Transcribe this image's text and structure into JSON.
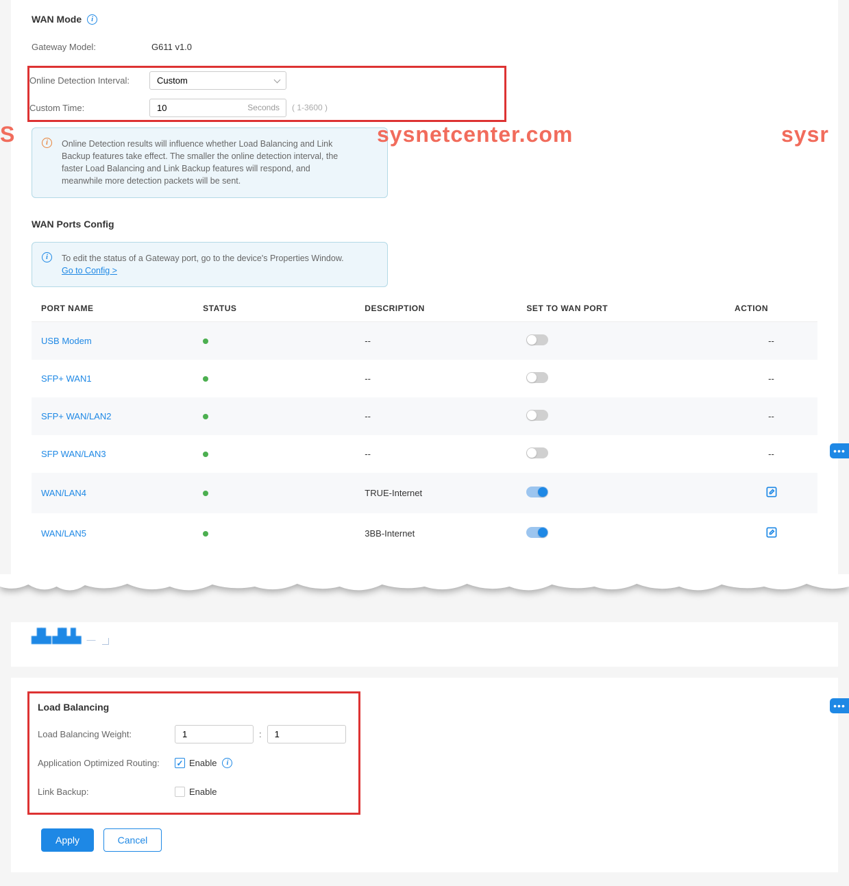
{
  "watermarks": {
    "w1": "S",
    "w2": "sysnetcenter.com",
    "w3": "sysr"
  },
  "wan_mode": {
    "title": "WAN Mode",
    "gateway_model_label": "Gateway Model:",
    "gateway_model_value": "G611 v1.0",
    "detection_label": "Online Detection Interval:",
    "detection_value": "Custom",
    "custom_time_label": "Custom Time:",
    "custom_time_value": "10",
    "custom_time_unit": "Seconds",
    "custom_time_range": "( 1-3600 )",
    "info_text": "Online Detection results will influence whether Load Balancing and Link Backup features take effect. The smaller the online detection interval, the faster Load Balancing and Link Backup features will respond, and meanwhile more detection packets will be sent."
  },
  "wan_ports": {
    "title": "WAN Ports Config",
    "info_text": "To edit the status of a Gateway port, go to the device's Properties Window.",
    "info_link": "Go to Config >",
    "headers": {
      "port": "PORT NAME",
      "status": "STATUS",
      "desc": "DESCRIPTION",
      "wan": "SET TO WAN PORT",
      "action": "ACTION"
    },
    "rows": [
      {
        "name": "USB Modem",
        "desc": "--",
        "wan": false,
        "action": "--"
      },
      {
        "name": "SFP+ WAN1",
        "desc": "--",
        "wan": false,
        "action": "--"
      },
      {
        "name": "SFP+ WAN/LAN2",
        "desc": "--",
        "wan": false,
        "action": "--"
      },
      {
        "name": "SFP WAN/LAN3",
        "desc": "--",
        "wan": false,
        "action": "--"
      },
      {
        "name": "WAN/LAN4",
        "desc": "TRUE-Internet",
        "wan": true,
        "action": "edit"
      },
      {
        "name": "WAN/LAN5",
        "desc": "3BB-Internet",
        "wan": true,
        "action": "edit"
      }
    ]
  },
  "load_balancing": {
    "title": "Load Balancing",
    "weight_label": "Load Balancing Weight:",
    "weight1": "1",
    "weight2": "1",
    "aor_label": "Application Optimized Routing:",
    "aor_enable": "Enable",
    "aor_checked": true,
    "link_backup_label": "Link Backup:",
    "link_backup_enable": "Enable",
    "link_backup_checked": false
  },
  "buttons": {
    "apply": "Apply",
    "cancel": "Cancel"
  }
}
